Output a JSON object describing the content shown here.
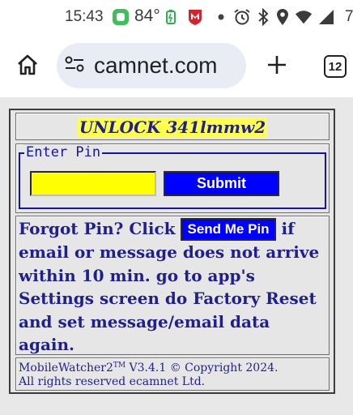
{
  "status_bar": {
    "time": "15:43",
    "temperature": "84°",
    "battery_percent": "7",
    "icons": [
      "chat-app-icon",
      "battery-saver-icon",
      "mcafee-icon",
      "dot-icon",
      "alarm-icon",
      "bluetooth-icon",
      "location-icon",
      "wifi-icon",
      "signal-icon"
    ]
  },
  "browser": {
    "url": "camnet.com",
    "tab_count": "12",
    "icons": [
      "home-icon",
      "site-settings-icon",
      "plus-icon"
    ]
  },
  "app": {
    "title": "UNLOCK 341lmmw2",
    "pin_legend": "Enter Pin",
    "pin_value": "",
    "submit_label": "Submit",
    "forgot_prefix": "Forgot Pin? Click",
    "send_pin_label": "Send Me Pin",
    "forgot_suffix": "if email or message does not arrive within 10 min. go to app's Settings screen do Factory Reset and set message/email data again.",
    "footer_app_name": "MobileWatcher2",
    "footer_tm": "TM",
    "footer_line1_rest": " V3.4.1 © Copyright 2024.",
    "footer_line2": "All rights reserved ecamnet Ltd."
  },
  "colors": {
    "title_highlight": "#ffff4d",
    "text_navy": "#1f1f8f",
    "button_blue": "#0000ff",
    "pin_input_yellow": "#ffff00",
    "legend_blue": "#1414a8"
  }
}
